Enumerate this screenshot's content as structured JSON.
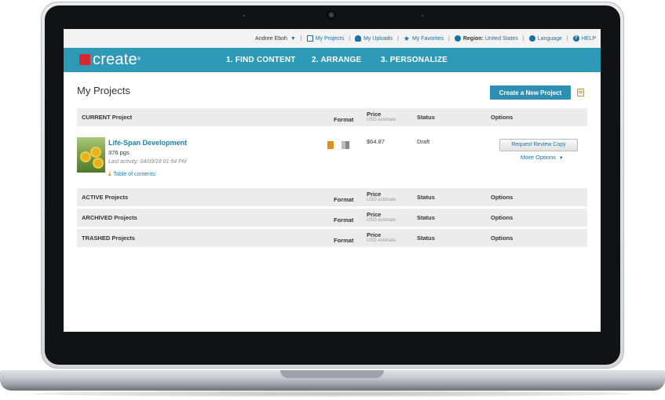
{
  "utility_bar": {
    "user_name": "Andree Eboh",
    "my_projects": "My Projects",
    "my_uploads": "My Uploads",
    "my_favorites": "My Favorites",
    "region_label": "Region:",
    "region_value": "United States",
    "language": "Language",
    "help": "HELP"
  },
  "nav": {
    "logo_text": "create",
    "logo_reg": "®",
    "steps": [
      "1. FIND CONTENT",
      "2. ARRANGE",
      "3. PERSONALIZE"
    ]
  },
  "page": {
    "title": "My Projects",
    "create_button": "Create a New Project"
  },
  "table_columns": {
    "format": "Format",
    "price": "Price",
    "price_sub": "USD estimate",
    "status": "Status",
    "options": "Options"
  },
  "sections": {
    "current": "CURRENT Project",
    "active": "ACTIVE Projects",
    "archived": "ARCHIVED Projects",
    "trashed": "TRASHED Projects"
  },
  "current_project": {
    "title": "Life-Span Development",
    "pages": "376 pgs",
    "last_activity": "Last activity: 04/09/18 01:54 PM",
    "toc": "Table of contents:",
    "price": "$64.87",
    "status": "Draft",
    "review_button": "Request Review Copy",
    "more_options": "More Options"
  },
  "colors": {
    "nav_bg": "#2e9ab8",
    "link": "#1b6fa8",
    "accent_orange": "#e38d1a"
  }
}
